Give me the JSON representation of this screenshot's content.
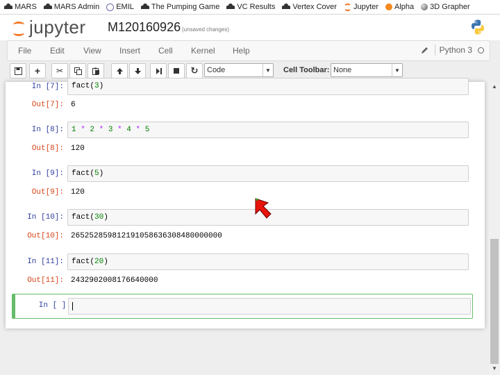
{
  "bookmarks": [
    {
      "label": "MARS",
      "icon": "hat-icon"
    },
    {
      "label": "MARS Admin",
      "icon": "hat-icon"
    },
    {
      "label": "EMIL",
      "icon": "emil-icon"
    },
    {
      "label": "The Pumping Game",
      "icon": "hat-icon"
    },
    {
      "label": "VC Results",
      "icon": "hat-icon"
    },
    {
      "label": "Vertex Cover",
      "icon": "hat-icon"
    },
    {
      "label": "Jupyter",
      "icon": "jupyter-icon"
    },
    {
      "label": "Alpha",
      "icon": "alpha-icon"
    },
    {
      "label": "3D Grapher",
      "icon": "grapher-icon"
    }
  ],
  "header": {
    "logo_text": "jupyter",
    "notebook_name": "M120160926",
    "save_status": "(unsaved changes)"
  },
  "menu": {
    "items": [
      "File",
      "Edit",
      "View",
      "Insert",
      "Cell",
      "Kernel",
      "Help"
    ],
    "kernel_name": "Python 3"
  },
  "toolbar": {
    "cell_type": "Code",
    "cell_toolbar_label": "Cell Toolbar:",
    "cell_toolbar_value": "None",
    "icons": [
      "save-icon",
      "add-cell-icon",
      "cut-icon",
      "copy-icon",
      "paste-icon",
      "move-up-icon",
      "move-down-icon",
      "run-icon",
      "stop-icon",
      "restart-icon"
    ]
  },
  "cells": [
    {
      "in_prompt": "In [7]:",
      "code": [
        {
          "t": "fact",
          "c": "plain"
        },
        {
          "t": "(",
          "c": "plain"
        },
        {
          "t": "3",
          "c": "num"
        },
        {
          "t": ")",
          "c": "plain"
        }
      ],
      "out_prompt": "Out[7]:",
      "output": "6"
    },
    {
      "in_prompt": "In [8]:",
      "code": [
        {
          "t": "1",
          "c": "num"
        },
        {
          "t": " * ",
          "c": "op"
        },
        {
          "t": "2",
          "c": "num"
        },
        {
          "t": " * ",
          "c": "op"
        },
        {
          "t": "3",
          "c": "num"
        },
        {
          "t": " * ",
          "c": "op"
        },
        {
          "t": "4",
          "c": "num"
        },
        {
          "t": " * ",
          "c": "op"
        },
        {
          "t": "5",
          "c": "num"
        }
      ],
      "out_prompt": "Out[8]:",
      "output": "120"
    },
    {
      "in_prompt": "In [9]:",
      "code": [
        {
          "t": "fact",
          "c": "plain"
        },
        {
          "t": "(",
          "c": "plain"
        },
        {
          "t": "5",
          "c": "num"
        },
        {
          "t": ")",
          "c": "plain"
        }
      ],
      "out_prompt": "Out[9]:",
      "output": "120"
    },
    {
      "in_prompt": "In [10]:",
      "code": [
        {
          "t": "fact",
          "c": "plain"
        },
        {
          "t": "(",
          "c": "plain"
        },
        {
          "t": "30",
          "c": "num"
        },
        {
          "t": ")",
          "c": "plain"
        }
      ],
      "out_prompt": "Out[10]:",
      "output": "265252859812191058636308480000000"
    },
    {
      "in_prompt": "In [11]:",
      "code": [
        {
          "t": "fact",
          "c": "plain"
        },
        {
          "t": "(",
          "c": "plain"
        },
        {
          "t": "20",
          "c": "num"
        },
        {
          "t": ")",
          "c": "plain"
        }
      ],
      "out_prompt": "Out[11]:",
      "output": "2432902008176640000"
    }
  ],
  "active_cell": {
    "in_prompt": "In [ ]:"
  },
  "colors": {
    "in_prompt": "#303f9f",
    "out_prompt": "#d84315",
    "number": "#008000",
    "operator": "#aa22ff",
    "active_border": "#66bb6a",
    "jupyter_orange": "#f37726"
  }
}
